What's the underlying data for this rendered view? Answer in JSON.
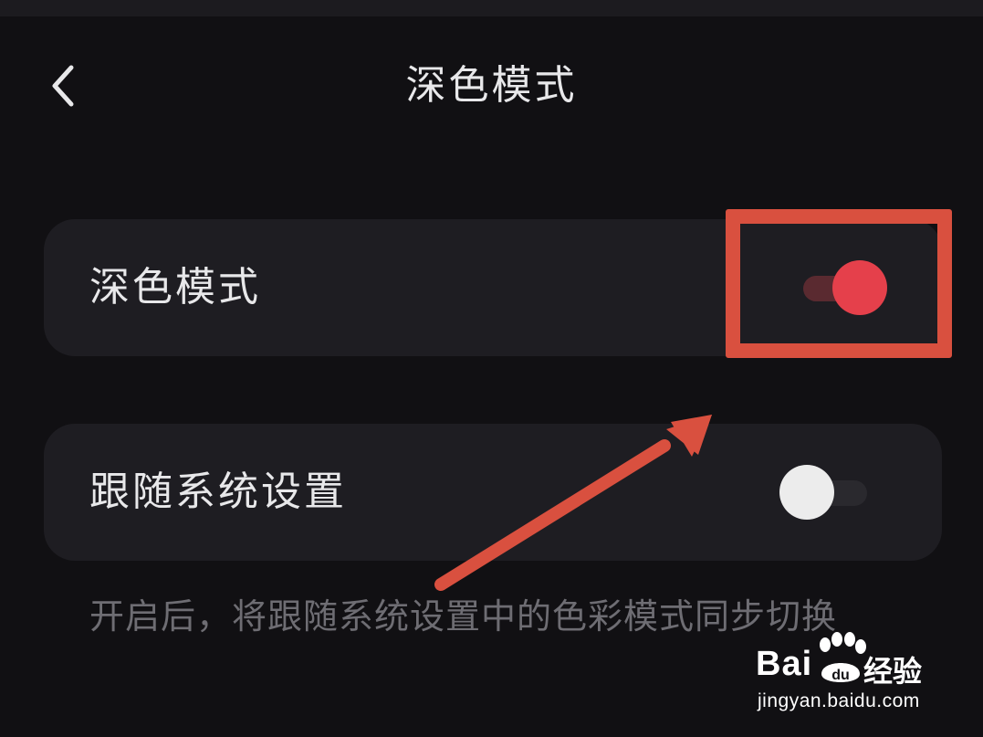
{
  "header": {
    "title": "深色模式",
    "back_icon": "chevron-left-icon"
  },
  "settings": [
    {
      "label": "深色模式",
      "enabled": true
    },
    {
      "label": "跟随系统设置",
      "enabled": false
    }
  ],
  "hint": "开启后，将跟随系统设置中的色彩模式同步切换",
  "colors": {
    "background": "#111013",
    "card": "#1e1d22",
    "text": "#e8e8ea",
    "hint_text": "#6e6d73",
    "toggle_on_knob": "#e5404b",
    "toggle_on_track": "#5a2a30",
    "toggle_off_knob": "#ececec",
    "toggle_off_track": "#2a292e",
    "annotation": "#d9503f"
  },
  "watermark": {
    "brand": "Bai",
    "brand_suffix": "经验",
    "url": "jingyan.baidu.com"
  }
}
